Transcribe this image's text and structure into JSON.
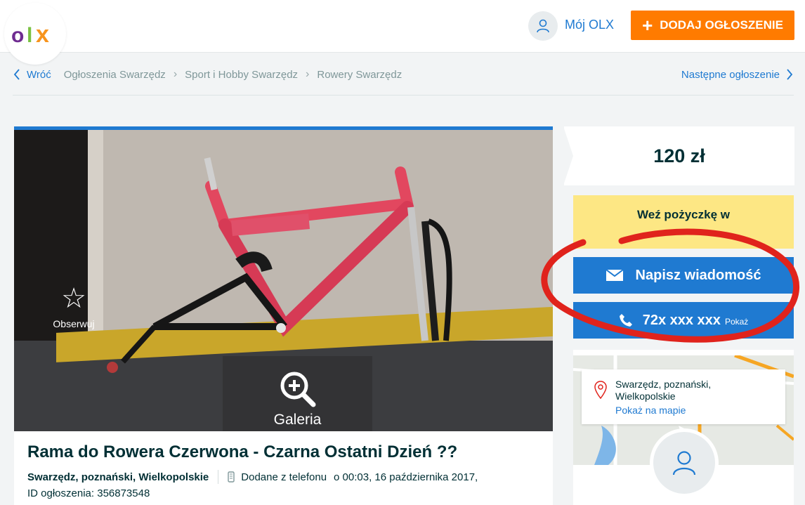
{
  "header": {
    "my_olx": "Mój OLX",
    "add_button": "DODAJ OGŁOSZENIE",
    "add_plus": "+"
  },
  "breadcrumb": {
    "back": "Wróć",
    "items": [
      "Ogłoszenia Swarzędz",
      "Sport i Hobby Swarzędz",
      "Rowery Swarzędz"
    ],
    "next": "Następne ogłoszenie"
  },
  "photo": {
    "observe_label": "Obserwuj",
    "gallery_label": "Galeria"
  },
  "ad": {
    "title": "Rama do Rowera Czerwona - Czarna Ostatni Dzień ??",
    "location": "Swarzędz, poznański, Wielkopolskie",
    "added_from": "Dodane z telefonu",
    "date": "o 00:03, 16 października 2017,",
    "ad_id": "ID ogłoszenia: 356873548"
  },
  "sidebar": {
    "price": "120 zł",
    "loan_text": "Weź pożyczkę w",
    "loan_text_2": "",
    "message_button": "Napisz wiadomość",
    "phone_number": "72x xxx xxx",
    "phone_show": "Pokaż",
    "map_address_line1": "Swarzędz, poznański,",
    "map_address_line2": "Wielkopolskie",
    "map_link": "Pokaż na mapie"
  },
  "colors": {
    "brand_orange": "#ff7b00",
    "link_blue": "#1f7ad1",
    "loan_yellow": "#fde784",
    "annotation_red": "#e0231c"
  }
}
